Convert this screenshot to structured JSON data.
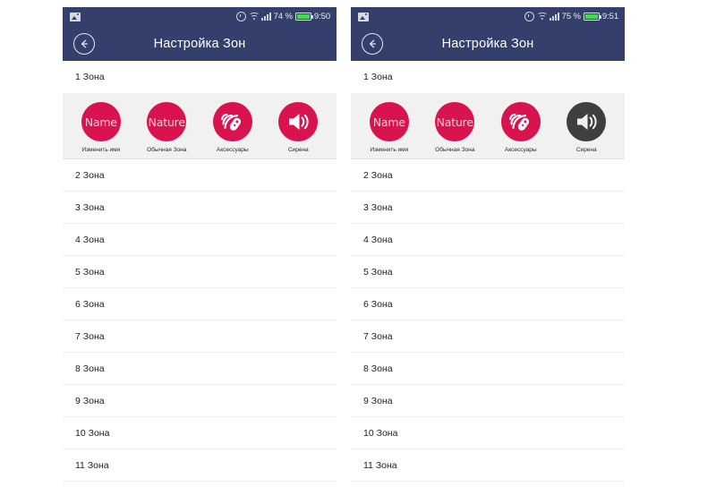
{
  "colors": {
    "appbar": "#353f6b",
    "accent_pink": "#d8134f",
    "accent_dark": "#3f3f3f",
    "panel_bg": "#f1f1f1",
    "battery_green": "#3ddc54"
  },
  "panels": [
    {
      "id": "left",
      "statusbar": {
        "image_icon": "image-icon",
        "alarm_icon": "alarm-clock-icon",
        "wifi_icon": "wifi-icon",
        "signal_icon": "signal-bars-icon",
        "battery_percent": "74 %",
        "battery_icon": "battery-icon",
        "time": "9:50"
      },
      "appbar": {
        "back_icon": "back-arrow-icon",
        "title": "Настройка Зон"
      },
      "first_zone": "1 Зона",
      "actions": [
        {
          "icon": "name-badge-icon",
          "icon_text": "Name",
          "label": "Изменить имя",
          "state": "active"
        },
        {
          "icon": "nature-badge-icon",
          "icon_text": "Nature",
          "label": "Обычная Зона",
          "state": "active"
        },
        {
          "icon": "remote-control-icon",
          "icon_text": "",
          "label": "Аксессуары",
          "state": "active"
        },
        {
          "icon": "siren-speaker-icon",
          "icon_text": "",
          "label": "Сирена",
          "state": "active"
        }
      ],
      "zones": [
        "2 Зона",
        "3 Зона",
        "4 Зона",
        "5 Зона",
        "6 Зона",
        "7 Зона",
        "8 Зона",
        "9 Зона",
        "10 Зона",
        "11 Зона"
      ]
    },
    {
      "id": "right",
      "statusbar": {
        "image_icon": "image-icon",
        "alarm_icon": "alarm-clock-icon",
        "wifi_icon": "wifi-icon",
        "signal_icon": "signal-bars-icon",
        "battery_percent": "75 %",
        "battery_icon": "battery-icon",
        "time": "9:51"
      },
      "appbar": {
        "back_icon": "back-arrow-icon",
        "title": "Настройка Зон"
      },
      "first_zone": "1 Зона",
      "actions": [
        {
          "icon": "name-badge-icon",
          "icon_text": "Name",
          "label": "Изменить имя",
          "state": "active"
        },
        {
          "icon": "nature-badge-icon",
          "icon_text": "Nature",
          "label": "Обычная Зона",
          "state": "active"
        },
        {
          "icon": "remote-control-icon",
          "icon_text": "",
          "label": "Аксессуары",
          "state": "active"
        },
        {
          "icon": "siren-speaker-icon",
          "icon_text": "",
          "label": "Сирена",
          "state": "disabled"
        }
      ],
      "zones": [
        "2 Зона",
        "3 Зона",
        "4 Зона",
        "5 Зона",
        "6 Зона",
        "7 Зона",
        "8 Зона",
        "9 Зона",
        "10 Зона",
        "11 Зона"
      ]
    }
  ]
}
